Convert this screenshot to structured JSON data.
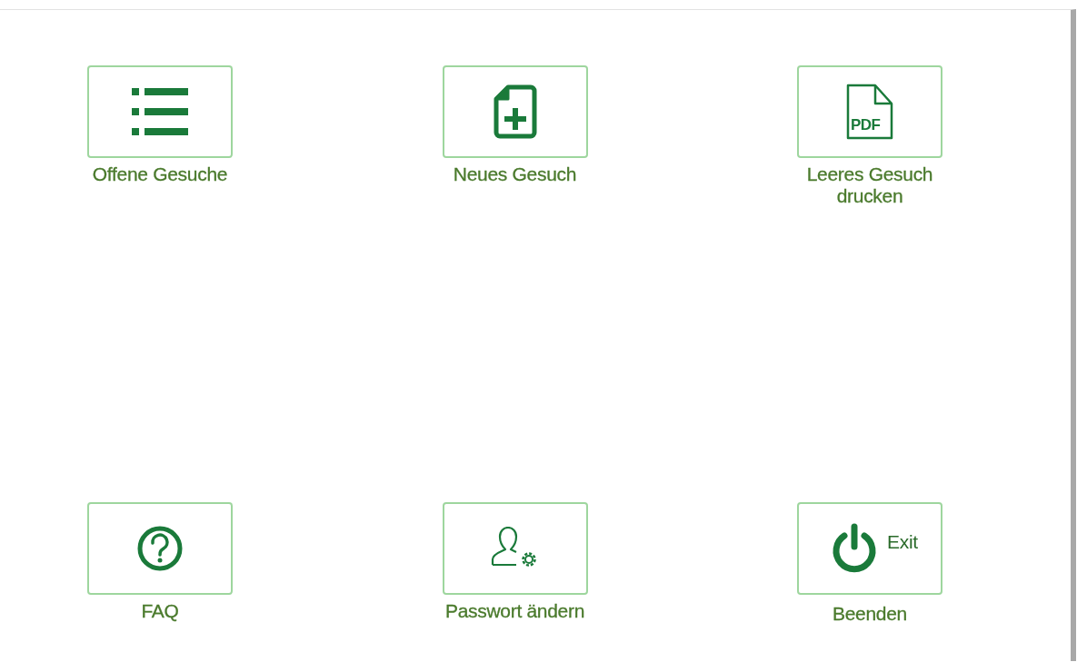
{
  "tiles": [
    {
      "kind": "list",
      "label": "Offene Gesuche"
    },
    {
      "kind": "new-document",
      "label": "Neues Gesuch"
    },
    {
      "kind": "pdf",
      "icon_text": "PDF",
      "label": "Leeres Gesuch drucken"
    },
    {
      "kind": "help",
      "label": "FAQ"
    },
    {
      "kind": "user-settings",
      "label": "Passwort ändern"
    },
    {
      "kind": "power",
      "button_text": "Exit",
      "label": "Beenden"
    }
  ]
}
